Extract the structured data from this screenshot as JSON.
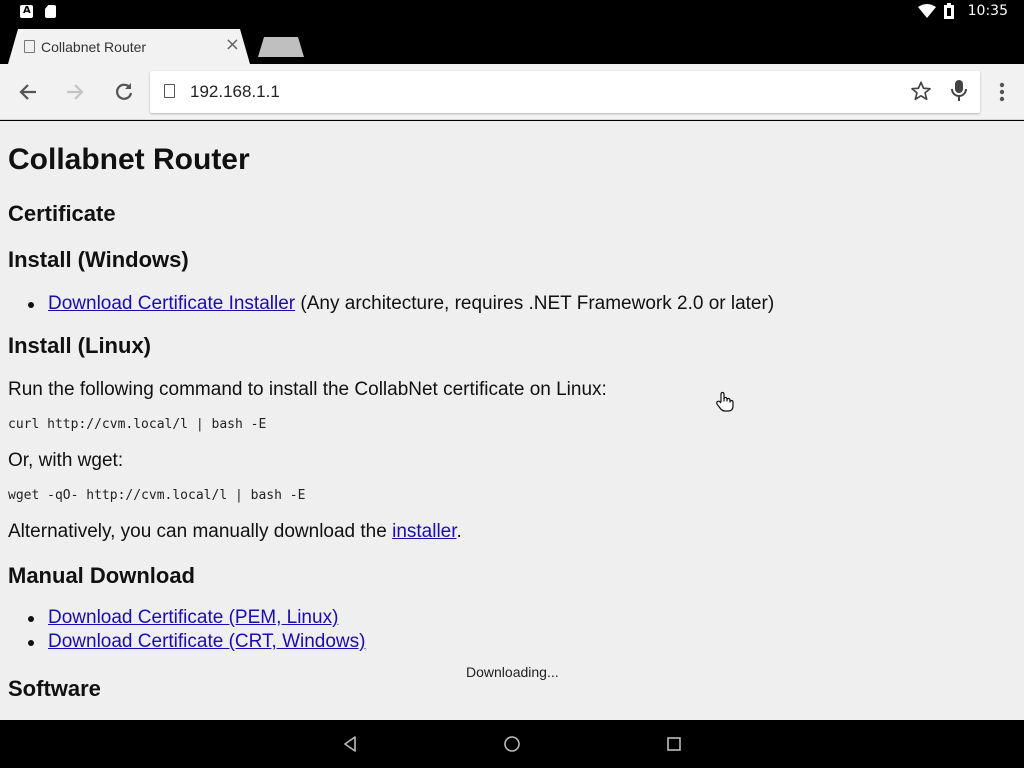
{
  "status_bar": {
    "left_icons": [
      "a-notification-icon",
      "sd-card-icon"
    ],
    "right_icons": [
      "wifi-icon",
      "battery-icon"
    ],
    "time": "10:35"
  },
  "tab": {
    "title": "Collabnet Router",
    "close_glyph": "×"
  },
  "toolbar": {
    "url": "192.168.1.1"
  },
  "page": {
    "title": "Collabnet Router",
    "section_certificate": "Certificate",
    "section_install_windows": "Install (Windows)",
    "windows_link": "Download Certificate Installer",
    "windows_note": " (Any architecture, requires .NET Framework 2.0 or later)",
    "section_install_linux": "Install (Linux)",
    "linux_intro": "Run the following command to install the CollabNet certificate on Linux:",
    "curl_command": "curl http://cvm.local/l | bash -E",
    "wget_intro": "Or, with wget:",
    "wget_command": "wget -qO- http://cvm.local/l | bash -E",
    "alt_prefix": "Alternatively, you can manually download the ",
    "alt_link": "installer",
    "alt_suffix": ".",
    "section_manual": "Manual Download",
    "manual_links": [
      "Download Certificate (PEM, Linux)",
      "Download Certificate (CRT, Windows)"
    ],
    "section_software": "Software"
  },
  "toast": {
    "text": "Downloading..."
  },
  "colors": {
    "link": "#1a0dab",
    "page_bg": "#efefef",
    "chrome_bg": "#f2f2f2"
  }
}
